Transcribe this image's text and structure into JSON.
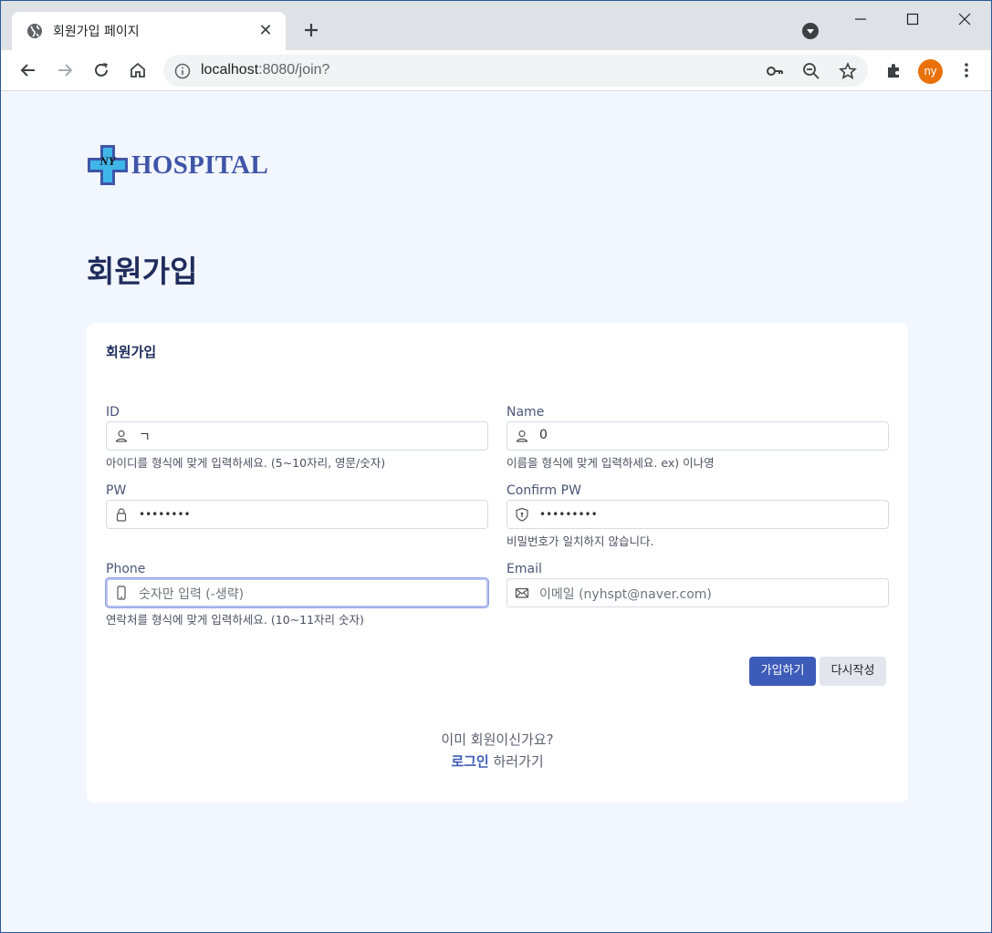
{
  "browser": {
    "tab_title": "회원가입 페이지",
    "tab_close": "✕",
    "url_host": "localhost",
    "url_path": ":8080/join?",
    "profile_initials": "ny",
    "accent_color": "#e8710a"
  },
  "brand": {
    "logo_mark": "NY",
    "logo_text": "HOSPITAL",
    "color": "#3f55a8"
  },
  "page": {
    "title": "회원가입"
  },
  "form": {
    "card_title": "회원가입",
    "fields": {
      "id": {
        "label": "ID",
        "value": "ㄱ",
        "helper": "아이디를 형식에 맞게 입력하세요. (5~10자리, 영문/숫자)",
        "icon": "user-icon"
      },
      "name": {
        "label": "Name",
        "value": "0",
        "helper": "이름을 형식에 맞게 입력하세요. ex) 이나영",
        "icon": "user-icon"
      },
      "pw": {
        "label": "PW",
        "value": "••••••••",
        "icon": "lock-icon"
      },
      "confirm_pw": {
        "label": "Confirm PW",
        "value": "•••••••••",
        "helper": "비밀번호가 일치하지 않습니다.",
        "icon": "shield-icon"
      },
      "phone": {
        "label": "Phone",
        "placeholder": "숫자만 입력 (-생략)",
        "helper": "연락처를 형식에 맞게 입력하세요. (10~11자리 숫자)",
        "icon": "phone-icon"
      },
      "email": {
        "label": "Email",
        "placeholder": "이메일 (nyhspt@naver.com)",
        "icon": "mail-icon"
      }
    },
    "submit_label": "가입하기",
    "reset_label": "다시작성",
    "primary_color": "#3d5bb8"
  },
  "footer": {
    "already_text": "이미 회원이신가요?",
    "login_link": "로그인",
    "login_suffix": " 하러가기"
  }
}
